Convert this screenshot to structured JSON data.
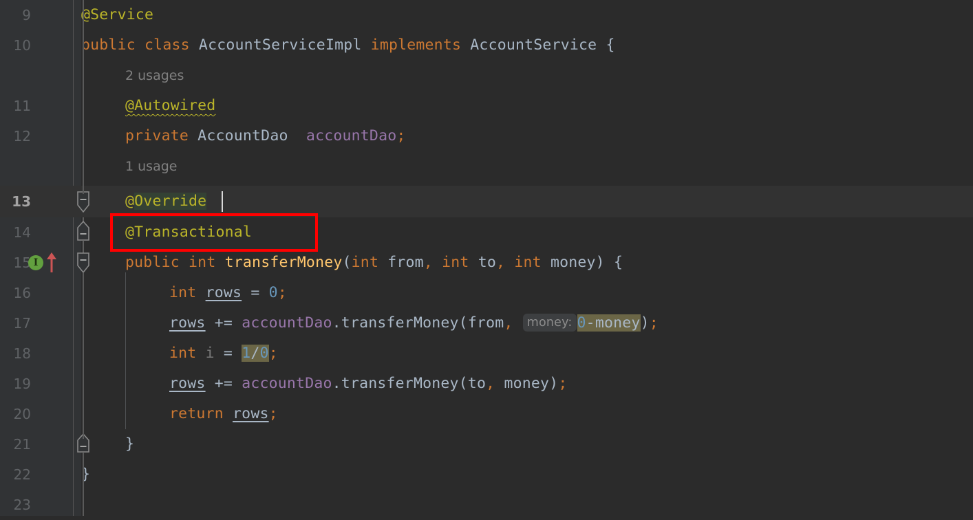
{
  "editor": {
    "theme": "darcula",
    "background": "#2b2b2b",
    "gutter_background": "#313335",
    "current_line_background": "#323232",
    "current_line_number": 13,
    "first_visible_line": 9,
    "last_visible_line": 23,
    "line_height_px": 44,
    "colors": {
      "keyword": "#cc7832",
      "annotation": "#bbb529",
      "identifier": "#a9b7c6",
      "field": "#9876aa",
      "method": "#ffc66d",
      "number": "#6897bb",
      "comment_hint": "#808080",
      "search_highlight": "#6b6646",
      "identifier_highlight": "#344134",
      "annotation_box": "#ff0000",
      "implements_marker": "#62a03f",
      "overrides_arrow": "#cc5555"
    }
  },
  "line_numbers": [
    "9",
    "10",
    "11",
    "12",
    "13",
    "14",
    "15",
    "16",
    "17",
    "18",
    "19",
    "20",
    "21",
    "22",
    "23"
  ],
  "inlay_hints": [
    {
      "line": 10,
      "text": "2 usages"
    },
    {
      "line": 12,
      "text": "1 usage"
    }
  ],
  "code_lines": {
    "l9": "@Service",
    "l10": "public class AccountServiceImpl implements AccountService {",
    "l11": "@Autowired",
    "l12": "private AccountDao  accountDao;",
    "l13": "@Override",
    "l14": "@Transactional",
    "l15": "public int transferMoney(int from, int to, int money) {",
    "l16": "int rows = 0;",
    "l17": "rows += accountDao.transferMoney(from, 0-money);",
    "l18": "int i = 1/0;",
    "l19": "rows += accountDao.transferMoney(to, money);",
    "l20": "return rows;",
    "l21": "}",
    "l22": "}",
    "l23": ""
  },
  "tokens": {
    "at": "@",
    "service": "Service",
    "public": "public",
    "class": "class",
    "AccountServiceImpl": "AccountServiceImpl",
    "implements": "implements",
    "AccountService": "AccountService",
    "brace_open": "{",
    "brace_close": "}",
    "Autowired": "Autowired",
    "private": "private",
    "AccountDao": "AccountDao",
    "accountDao_field": "accountDao",
    "semicolon": ";",
    "Override": "Override",
    "Transactional": "Transactional",
    "int": "int",
    "transferMoney": "transferMoney",
    "paren_open": "(",
    "paren_close": ")",
    "from": "from",
    "to": "to",
    "money": "money",
    "comma": ",",
    "rows": "rows",
    "assign": "=",
    "plus_assign": "+=",
    "zero": "0",
    "one": "1",
    "slash": "/",
    "minus": "-",
    "dot": ".",
    "i": "i",
    "return": "return",
    "space": " "
  },
  "parameter_hint": {
    "label": "money:",
    "on_line": 17
  },
  "highlights": [
    {
      "line": 13,
      "text": "Override",
      "color": "#344134",
      "kind": "identifier-occurrence"
    },
    {
      "line": 17,
      "text": "0-money",
      "color": "#6b6646",
      "kind": "search-match"
    },
    {
      "line": 18,
      "text": "1/0",
      "color": "#6b6646",
      "kind": "search-match"
    }
  ],
  "annotation_overlay": {
    "label": "@Transactional",
    "line": 14,
    "color": "#ff0000",
    "border_px": 4
  },
  "gutter_icons": [
    {
      "line": 15,
      "name": "implementing-method-marker",
      "glyph": "I",
      "color": "#62a03f"
    },
    {
      "line": 15,
      "name": "overriding-method-arrow",
      "glyph": "↑",
      "color": "#cc5555"
    }
  ],
  "fold_markers": [
    {
      "line": 13,
      "state": "expanded",
      "shape": "down"
    },
    {
      "line": 14,
      "state": "expanded",
      "shape": "up"
    },
    {
      "line": 15,
      "state": "expanded",
      "shape": "down"
    },
    {
      "line": 21,
      "state": "expanded",
      "shape": "up"
    }
  ],
  "caret": {
    "line": 13,
    "after_text": "@Override"
  },
  "warnings": [
    {
      "line": 11,
      "text": "@Autowired",
      "kind": "weak-warning-squiggle",
      "color": "#bbb529"
    }
  ]
}
